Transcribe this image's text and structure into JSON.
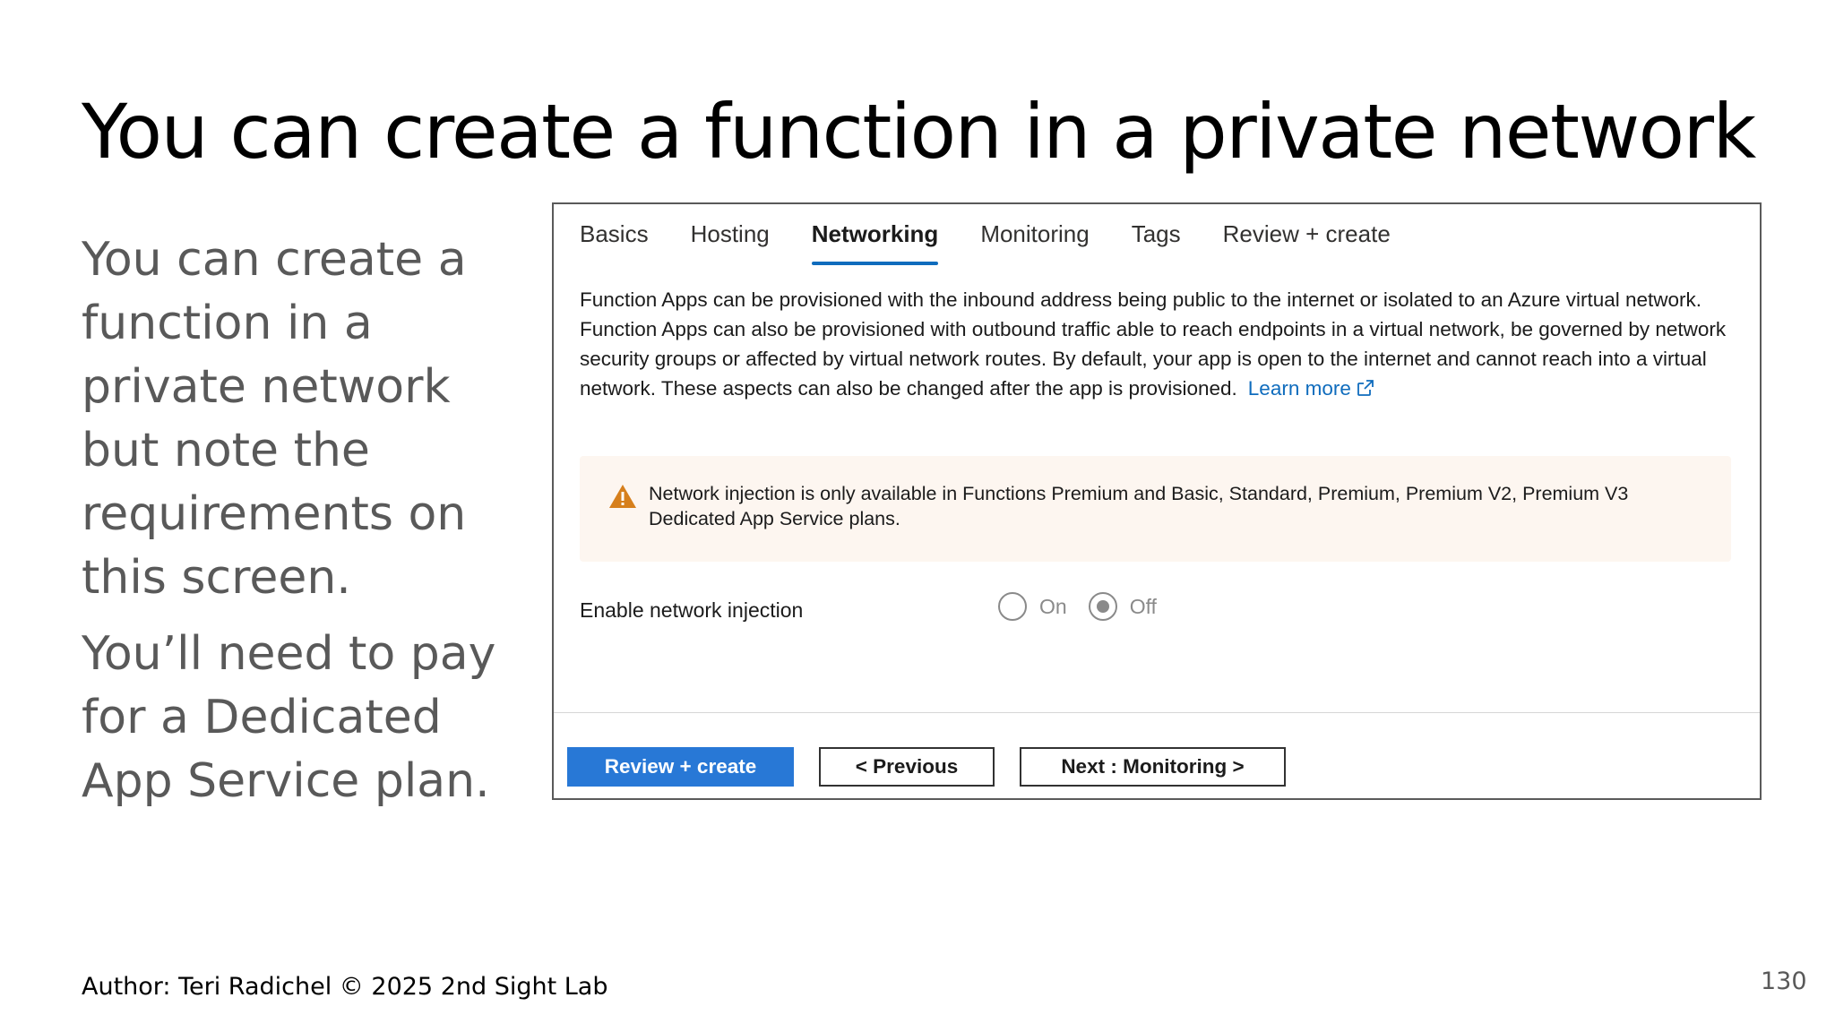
{
  "slide": {
    "title": "You can create a function in a private network",
    "body": [
      "You can create a function in a private network but note the requirements on this screen.",
      "You’ll need to pay for a Dedicated App Service plan."
    ],
    "author": "Author: Teri Radichel © 2025 2nd Sight Lab",
    "page_number": "130"
  },
  "panel": {
    "tabs": [
      {
        "label": "Basics",
        "active": false
      },
      {
        "label": "Hosting",
        "active": false
      },
      {
        "label": "Networking",
        "active": true
      },
      {
        "label": "Monitoring",
        "active": false
      },
      {
        "label": "Tags",
        "active": false
      },
      {
        "label": "Review + create",
        "active": false
      }
    ],
    "description": "Function Apps can be provisioned with the inbound address being public to the internet or isolated to an Azure virtual network. Function Apps can also be provisioned with outbound traffic able to reach endpoints in a virtual network, be governed by network security groups or affected by virtual network routes. By default, your app is open to the internet and cannot reach into a virtual network. These aspects can also be changed after the app is provisioned.",
    "learn_more": "Learn more",
    "warning": "Network injection is only available in Functions Premium and Basic, Standard, Premium, Premium V2, Premium V3 Dedicated App Service plans.",
    "enable_label": "Enable network injection",
    "radio_on": "On",
    "radio_off": "Off",
    "selected": "Off",
    "buttons": {
      "review_create": "Review + create",
      "previous": "< Previous",
      "next": "Next : Monitoring >"
    }
  },
  "colors": {
    "accent": "#0f6cbd",
    "primary_button": "#2878d6",
    "warning_icon": "#d67f1c",
    "warning_bg": "#fdf6f0"
  },
  "icons": {
    "external_link": "external-link-icon",
    "warning": "warning-triangle-icon"
  }
}
